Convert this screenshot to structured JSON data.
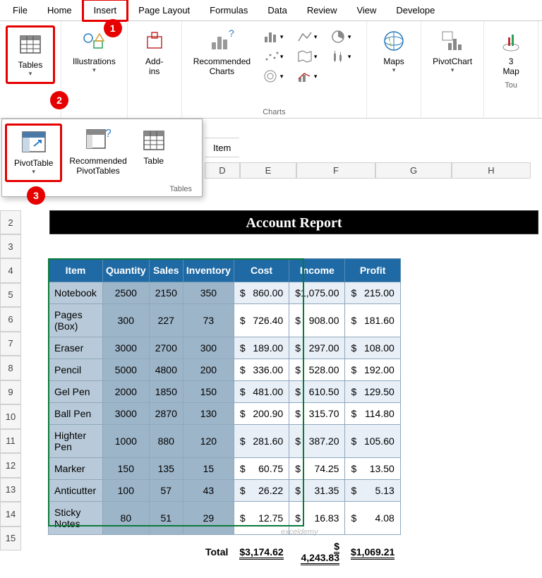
{
  "tabs": [
    "File",
    "Home",
    "Insert",
    "Page Layout",
    "Formulas",
    "Data",
    "Review",
    "View",
    "Develope"
  ],
  "active_tab_index": 2,
  "ribbon": {
    "tables": "Tables",
    "illustrations": "Illustrations",
    "addins": "Add-\nins",
    "recommended_charts": "Recommended\nCharts",
    "maps": "Maps",
    "pivotchart": "PivotChart",
    "threed_map": "3\nMap",
    "tours": "Tou",
    "charts_label": "Charts"
  },
  "dropdown": {
    "pivottable": "PivotTable",
    "recommended_pivottables": "Recommended\nPivotTables",
    "table": "Table",
    "footer": "Tables"
  },
  "formula_bar": "Item",
  "col_headers": [
    "D",
    "E",
    "F",
    "G",
    "H"
  ],
  "row_headers": [
    "2",
    "3",
    "4",
    "5",
    "6",
    "7",
    "8",
    "9",
    "10",
    "11",
    "12",
    "13",
    "14",
    "15"
  ],
  "report_title": "Account Report",
  "table_headers": [
    "Item",
    "Quantity",
    "Sales",
    "Inventory",
    "Cost",
    "Income",
    "Profit"
  ],
  "rows": [
    {
      "item": "Notebook",
      "qty": "2500",
      "sales": "2150",
      "inv": "350",
      "cost": "860.00",
      "income": "1,075.00",
      "profit": "215.00"
    },
    {
      "item": "Pages (Box)",
      "qty": "300",
      "sales": "227",
      "inv": "73",
      "cost": "726.40",
      "income": "908.00",
      "profit": "181.60"
    },
    {
      "item": "Eraser",
      "qty": "3000",
      "sales": "2700",
      "inv": "300",
      "cost": "189.00",
      "income": "297.00",
      "profit": "108.00"
    },
    {
      "item": "Pencil",
      "qty": "5000",
      "sales": "4800",
      "inv": "200",
      "cost": "336.00",
      "income": "528.00",
      "profit": "192.00"
    },
    {
      "item": "Gel Pen",
      "qty": "2000",
      "sales": "1850",
      "inv": "150",
      "cost": "481.00",
      "income": "610.50",
      "profit": "129.50"
    },
    {
      "item": "Ball Pen",
      "qty": "3000",
      "sales": "2870",
      "inv": "130",
      "cost": "200.90",
      "income": "315.70",
      "profit": "114.80"
    },
    {
      "item": "Highter Pen",
      "qty": "1000",
      "sales": "880",
      "inv": "120",
      "cost": "281.60",
      "income": "387.20",
      "profit": "105.60"
    },
    {
      "item": "Marker",
      "qty": "150",
      "sales": "135",
      "inv": "15",
      "cost": "60.75",
      "income": "74.25",
      "profit": "13.50"
    },
    {
      "item": "Anticutter",
      "qty": "100",
      "sales": "57",
      "inv": "43",
      "cost": "26.22",
      "income": "31.35",
      "profit": "5.13"
    },
    {
      "item": "Sticky Notes",
      "qty": "80",
      "sales": "51",
      "inv": "29",
      "cost": "12.75",
      "income": "16.83",
      "profit": "4.08"
    }
  ],
  "totals": {
    "label": "Total",
    "cost": "$3,174.62",
    "income": "$ 4,243.83",
    "profit": "$1,069.21"
  },
  "annotations": [
    "1",
    "2",
    "3"
  ],
  "watermark": "exceldemy"
}
